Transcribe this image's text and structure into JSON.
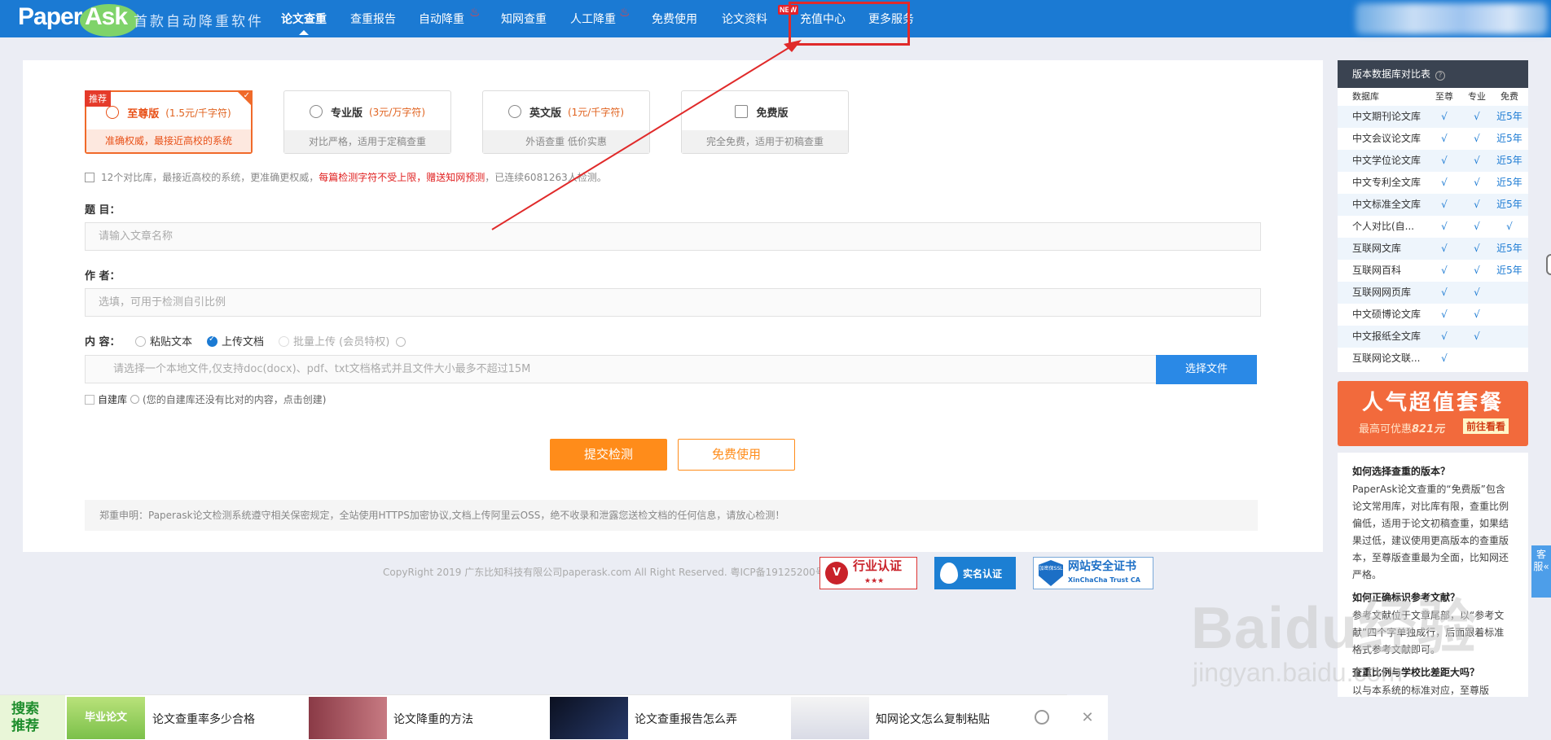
{
  "header": {
    "logo_left": "Paper",
    "logo_right": "Ask",
    "slogan": "首款自动降重软件",
    "nav": [
      {
        "label": "论文查重",
        "active": true
      },
      {
        "label": "查重报告"
      },
      {
        "label": "自动降重",
        "hot": true
      },
      {
        "label": "知网查重"
      },
      {
        "label": "人工降重",
        "hot": true
      },
      {
        "label": "免费使用"
      },
      {
        "label": "论文资料",
        "badge": "NEW"
      },
      {
        "label": "充值中心"
      },
      {
        "label": "更多服务"
      }
    ]
  },
  "versions": [
    {
      "name": "至尊版",
      "price": "(1.5元/千字符)",
      "desc": "准确权威，最接近高校的系统",
      "badge": "推荐",
      "selected": true
    },
    {
      "name": "专业版",
      "price": "(3元/万字符)",
      "desc": "对比严格，适用于定稿查重"
    },
    {
      "name": "英文版",
      "price": "(1元/千字符)",
      "desc": "外语查重 低价实惠"
    },
    {
      "name": "免费版",
      "price": "",
      "desc": "完全免费，适用于初稿查重"
    }
  ],
  "info": {
    "part1": "12个对比库，最接近高校的系统，更准确更权威，",
    "part2": "每篇检测字符不受上限，赠送知网预测",
    "part3": "，已连续6081263人检测。"
  },
  "form": {
    "title_label": "题 目：",
    "title_placeholder": "请输入文章名称",
    "author_label": "作 者：",
    "author_placeholder": "选填，可用于检测自引比例",
    "content_label": "内 容：",
    "opt_paste": "粘贴文本",
    "opt_upload": "上传文档",
    "opt_batch": "批量上传 (会员特权)",
    "file_placeholder": "请选择一个本地文件,仅支持doc(docx)、pdf、txt文档格式并且文件大小最多不超过15M",
    "choose_file": "选择文件",
    "selfdb_label": "自建库",
    "selfdb_hint": "(您的自建库还没有比对的内容，点击创建)",
    "submit": "提交检测",
    "free": "免费使用"
  },
  "notice": "郑重申明：Paperask论文检测系统遵守相关保密规定，全站使用HTTPS加密协议,文档上传阿里云OSS，绝不收录和泄露您送检文档的任何信息，请放心检测！",
  "footer": {
    "copyright": "CopyRight 2019 广东比知科技有限公司paperask.com All Right Reserved. 粤ICP备19125200号-1",
    "cert1": "行业认证",
    "cert1_sub": "★★★",
    "cert2": "实名认证",
    "cert3": "网站安全证书",
    "cert3_sub": "XinChaCha Trust CA",
    "cert3_badge": "加密保SSL"
  },
  "sidebar": {
    "title": "版本数据库对比表",
    "headers": [
      "数据库",
      "至尊",
      "专业",
      "免费"
    ],
    "rows": [
      [
        "中文期刊论文库",
        "√",
        "√",
        "近5年"
      ],
      [
        "中文会议论文库",
        "√",
        "√",
        "近5年"
      ],
      [
        "中文学位论文库",
        "√",
        "√",
        "近5年"
      ],
      [
        "中文专利全文库",
        "√",
        "√",
        "近5年"
      ],
      [
        "中文标准全文库",
        "√",
        "√",
        "近5年"
      ],
      [
        "个人对比(自...",
        "√",
        "√",
        "√"
      ],
      [
        "互联网文库",
        "√",
        "√",
        "近5年"
      ],
      [
        "互联网百科",
        "√",
        "√",
        "近5年"
      ],
      [
        "互联网网页库",
        "√",
        "√",
        ""
      ],
      [
        "中文硕博论文库",
        "√",
        "√",
        ""
      ],
      [
        "中文报纸全文库",
        "√",
        "√",
        ""
      ],
      [
        "互联网论文联...",
        "√",
        "",
        ""
      ]
    ],
    "promo_title": "人气超值套餐",
    "promo_sub_pre": "最高可优惠",
    "promo_amount": "821元",
    "promo_go": "前往看看",
    "faq": [
      {
        "q": "如何选择查重的版本？",
        "a": "PaperAsk论文查重的“免费版”包含论文常用库，对比库有限，查重比例偏低，适用于论文初稿查重，如果结果过低，建议使用更高版本的查重版本，至尊版查重最为全面，比知网还严格。"
      },
      {
        "q": "如何正确标识参考文献？",
        "a": "参考文献位于文章尾部，以“参考文献”四个字单独成行，后面跟着标准格式参考文献即可。"
      },
      {
        "q": "查重比例与学校比差距大吗？",
        "a": "以与本系统的标准对应，至尊版"
      }
    ],
    "kefu": "客服«"
  },
  "watermark": {
    "main": "Baidu经验",
    "sub": "jingyan.baidu.com"
  },
  "bottom_bar": {
    "label": "搜索推荐",
    "items": [
      {
        "thumb": "毕业论文",
        "text": "论文查重率多少合格"
      },
      {
        "thumb": "",
        "text": "论文降重的方法"
      },
      {
        "thumb": "",
        "text": "论文查重报告怎么弄"
      },
      {
        "thumb": "",
        "text": "知网论文怎么复制粘贴"
      }
    ],
    "close": "✕"
  },
  "colors": {
    "brand": "#1b7ad3",
    "accent": "#ff8c1a",
    "highlight_box": "#e02a2a"
  }
}
